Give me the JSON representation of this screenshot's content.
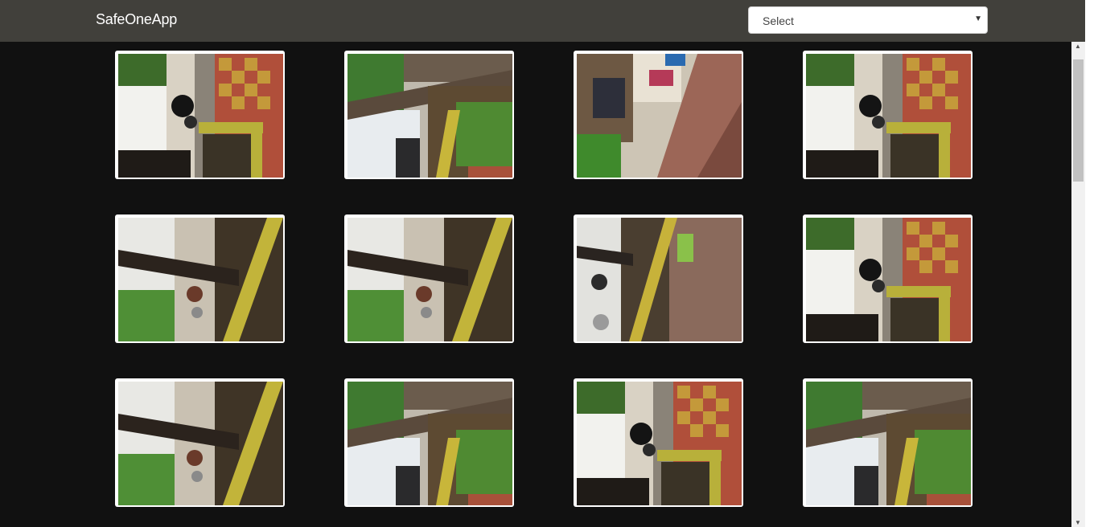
{
  "app": {
    "brand": "SafeOneApp"
  },
  "filter": {
    "selected": "Select"
  },
  "gallery": {
    "items": [
      {
        "scene": "street-bike-tiles"
      },
      {
        "scene": "tree-trunk-tiles"
      },
      {
        "scene": "shopfront-pavement"
      },
      {
        "scene": "street-bike-tiles"
      },
      {
        "scene": "tree-yellow-curb"
      },
      {
        "scene": "tree-yellow-curb"
      },
      {
        "scene": "yellow-curb-pavement"
      },
      {
        "scene": "street-bike-tiles"
      },
      {
        "scene": "tree-yellow-curb"
      },
      {
        "scene": "tree-trunk-tiles"
      },
      {
        "scene": "street-bike-tiles"
      },
      {
        "scene": "tree-trunk-tiles"
      }
    ]
  },
  "colors": {
    "navbar": "#41403b",
    "background": "#111111",
    "frame": "#ffffff"
  },
  "icons": {
    "select_caret": "chevron-down-icon",
    "scroll_up": "scroll-up-arrow-icon",
    "scroll_down": "scroll-down-arrow-icon"
  }
}
